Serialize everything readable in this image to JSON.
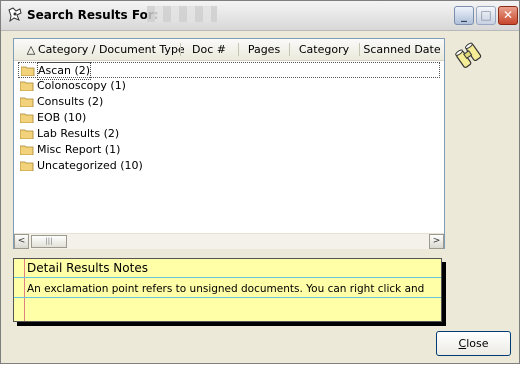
{
  "window": {
    "title": "Search Results For:"
  },
  "table": {
    "columns": [
      "Category / Document Type",
      "Doc #",
      "Pages",
      "Category",
      "Scanned Date"
    ],
    "sort_indicator": "△",
    "rows": [
      {
        "label": "Ascan (2)",
        "selected": true
      },
      {
        "label": "Colonoscopy (1)",
        "selected": false
      },
      {
        "label": "Consults (2)",
        "selected": false
      },
      {
        "label": "EOB (10)",
        "selected": false
      },
      {
        "label": "Lab Results (2)",
        "selected": false
      },
      {
        "label": "Misc Report (1)",
        "selected": false
      },
      {
        "label": "Uncategorized (10)",
        "selected": false
      }
    ]
  },
  "scrollbar": {
    "left_arrow": "<",
    "right_arrow": ">",
    "thumb_grip": "|||"
  },
  "notes": {
    "title": "Detail Results Notes",
    "text": "An exclamation point refers to unsigned documents.  You can right click and"
  },
  "footer": {
    "close_label_accel": "C",
    "close_label_rest": "lose"
  },
  "icons": {
    "app": "app-icon",
    "binoculars": "binoculars-icon",
    "folder": "folder-icon"
  },
  "colors": {
    "notes_bg": "#ffffa8",
    "notes_margin": "#e08080",
    "notes_rule": "#69c6d8",
    "close_ctl": "#c8472c"
  }
}
